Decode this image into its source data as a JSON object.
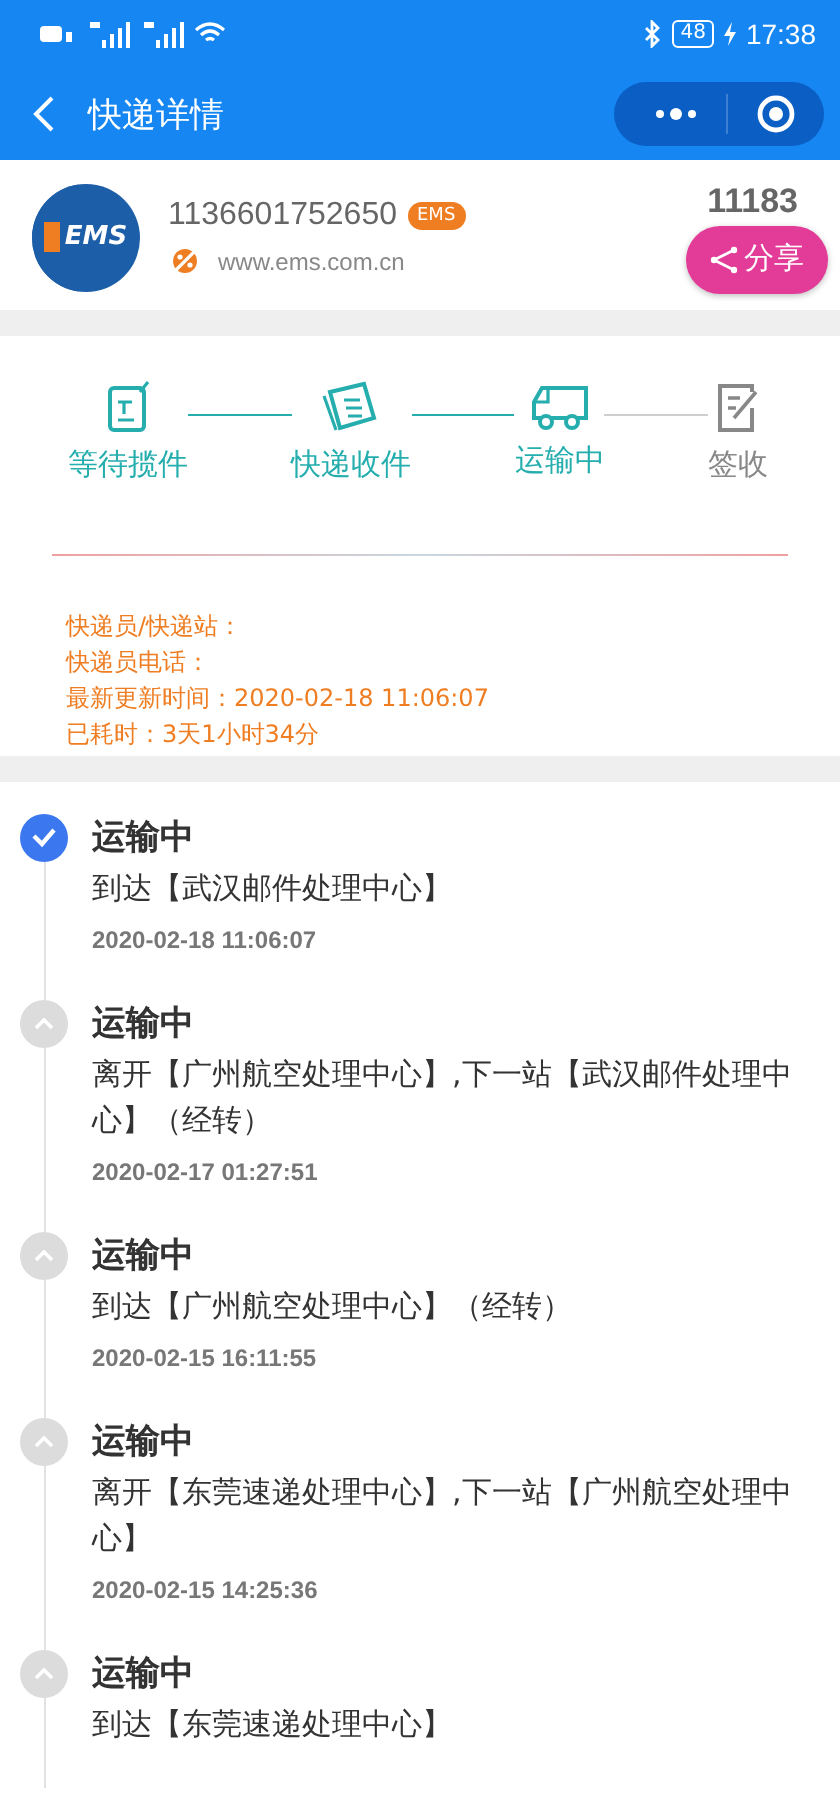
{
  "status_bar": {
    "battery": "48",
    "time": "17:38"
  },
  "nav": {
    "title": "快递详情"
  },
  "courier": {
    "logo_text": "EMS",
    "tracking_number": "1136601752650",
    "badge": "EMS",
    "website": "www.ems.com.cn",
    "phone": "11183",
    "share": "分享"
  },
  "steps": [
    {
      "label": "等待揽件",
      "kind": "pickup",
      "done": true
    },
    {
      "label": "快递收件",
      "kind": "received",
      "done": true
    },
    {
      "label": "运输中",
      "kind": "transit",
      "done": true
    },
    {
      "label": "签收",
      "kind": "signed",
      "done": false
    }
  ],
  "info": [
    "快递员/快递站：",
    "快递员电话：",
    "最新更新时间：2020-02-18 11:06:07",
    "已耗时：3天1小时34分"
  ],
  "timeline": [
    {
      "status": "运输中",
      "detail": "到达【武汉邮件处理中心】",
      "time": "2020-02-18 11:06:07",
      "current": true
    },
    {
      "status": "运输中",
      "detail": "离开【广州航空处理中心】,下一站【武汉邮件处理中心】（经转）",
      "time": "2020-02-17 01:27:51",
      "current": false
    },
    {
      "status": "运输中",
      "detail": "到达【广州航空处理中心】（经转）",
      "time": "2020-02-15 16:11:55",
      "current": false
    },
    {
      "status": "运输中",
      "detail": "离开【东莞速递处理中心】,下一站【广州航空处理中心】",
      "time": "2020-02-15 14:25:36",
      "current": false
    },
    {
      "status": "运输中",
      "detail": "到达【东莞速递处理中心】",
      "current": false
    }
  ]
}
